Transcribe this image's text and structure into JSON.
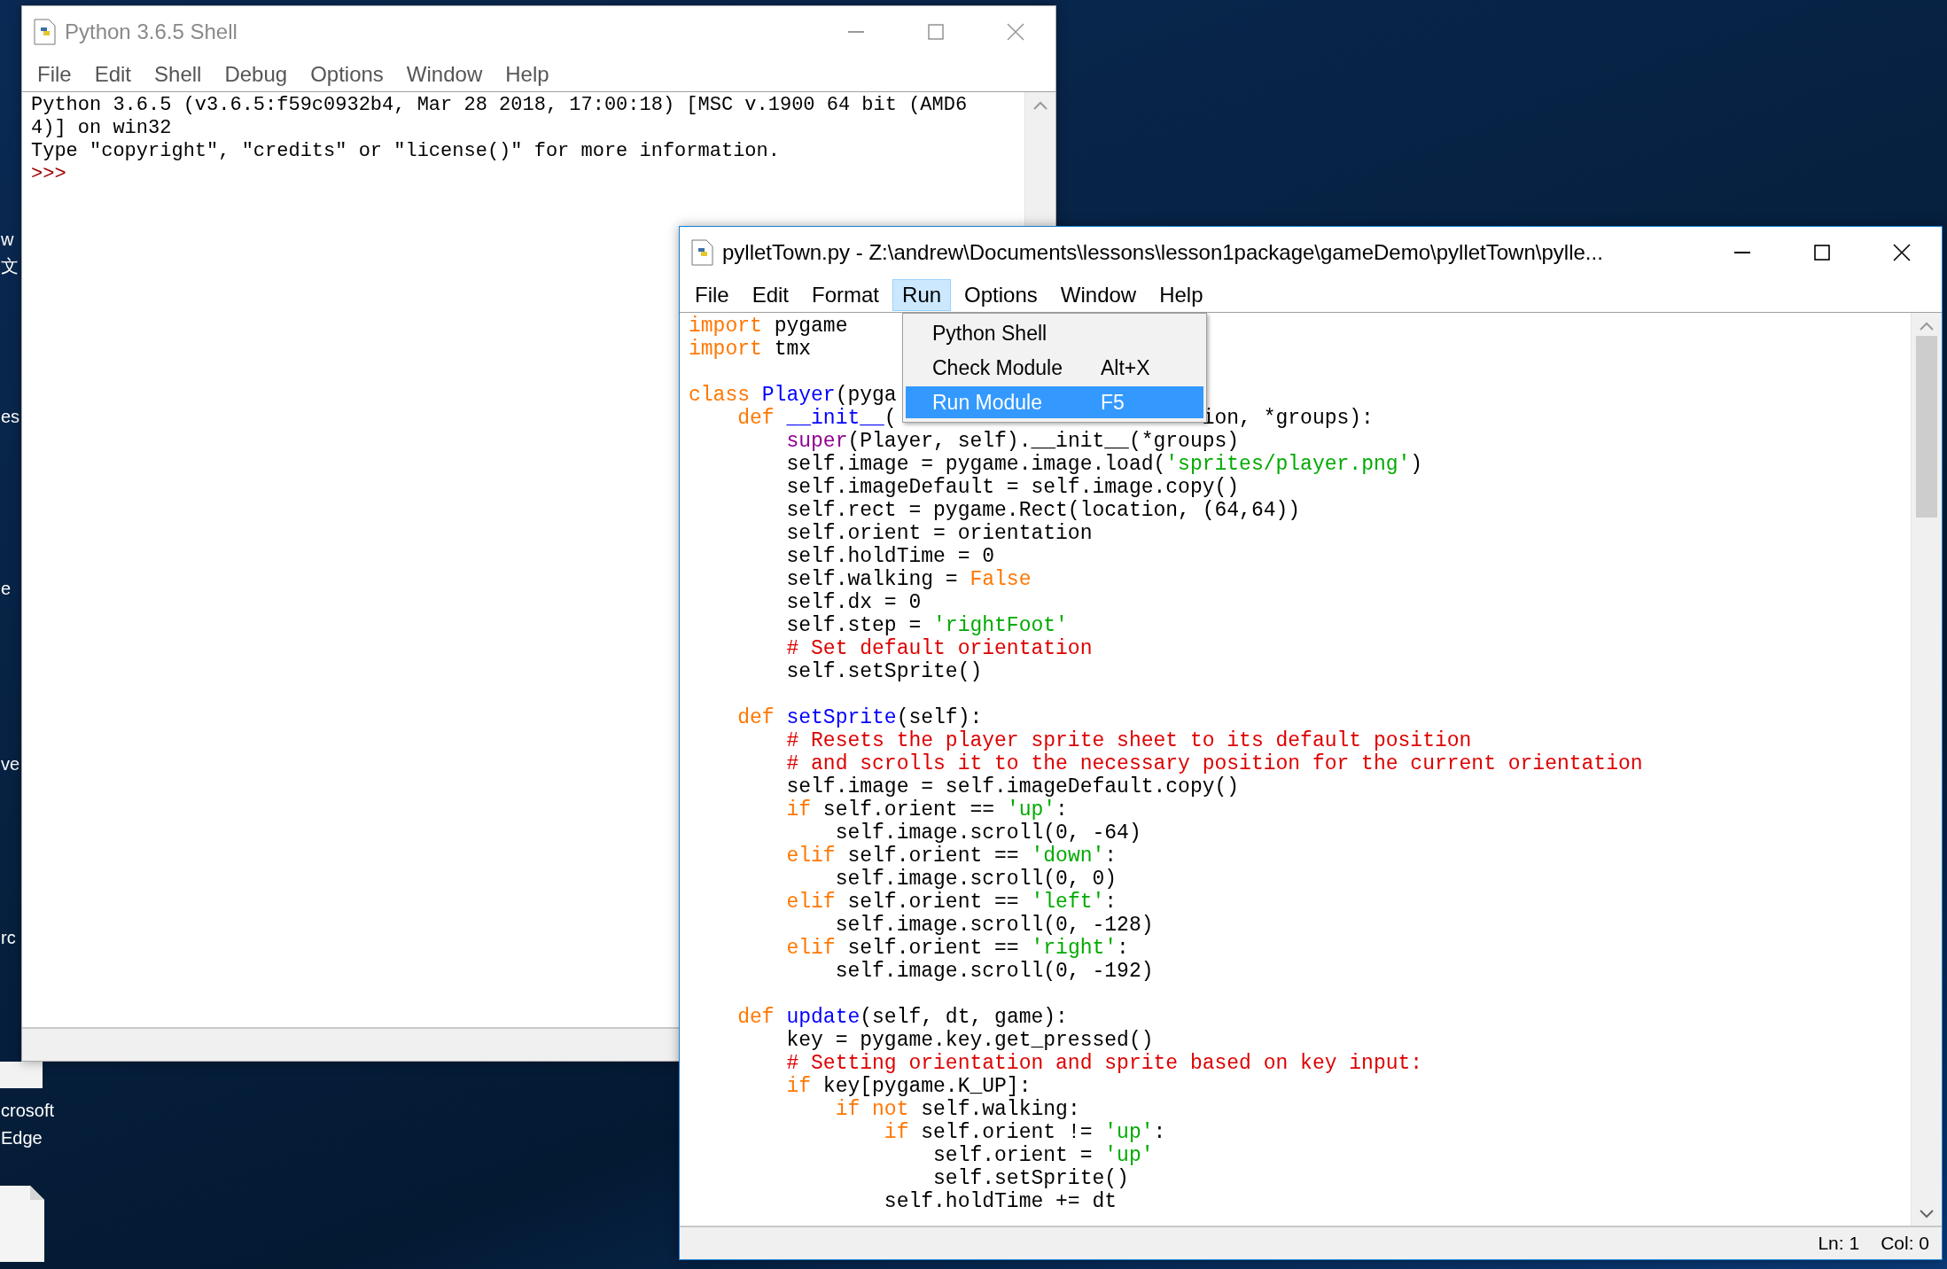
{
  "desktop": {
    "labels": [
      {
        "text": "w"
      },
      {
        "text": "文"
      },
      {
        "text": "es"
      },
      {
        "text": "e"
      },
      {
        "text": "ve"
      },
      {
        "text": "rc"
      },
      {
        "text": "crosoft"
      },
      {
        "text": "Edge"
      }
    ]
  },
  "shell_window": {
    "title": "Python 3.6.5 Shell",
    "active": false,
    "menu": [
      {
        "label": "File",
        "selected": false
      },
      {
        "label": "Edit",
        "selected": false
      },
      {
        "label": "Shell",
        "selected": false
      },
      {
        "label": "Debug",
        "selected": false
      },
      {
        "label": "Options",
        "selected": false
      },
      {
        "label": "Window",
        "selected": false
      },
      {
        "label": "Help",
        "selected": false
      }
    ],
    "output": [
      {
        "kind": "text",
        "text": "Python 3.6.5 (v3.6.5:f59c0932b4, Mar 28 2018, 17:00:18) [MSC v.1900 64 bit (AMD6"
      },
      {
        "kind": "text",
        "text": "4)] on win32"
      },
      {
        "kind": "text",
        "text": "Type \"copyright\", \"credits\" or \"license()\" for more information."
      },
      {
        "kind": "prompt",
        "text": ">>>"
      }
    ]
  },
  "editor_window": {
    "title": "pylletTown.py - Z:\\andrew\\Documents\\lessons\\lesson1package\\gameDemo\\pylletTown\\pylle...",
    "active": true,
    "menu": [
      {
        "label": "File",
        "selected": false
      },
      {
        "label": "Edit",
        "selected": false
      },
      {
        "label": "Format",
        "selected": false
      },
      {
        "label": "Run",
        "selected": true
      },
      {
        "label": "Options",
        "selected": false
      },
      {
        "label": "Window",
        "selected": false
      },
      {
        "label": "Help",
        "selected": false
      }
    ],
    "run_menu": [
      {
        "label": "Python Shell",
        "selected": false
      },
      {
        "label": "Check Module",
        "shortcut": "Alt+X",
        "selected": false
      },
      {
        "label": "Run Module",
        "shortcut": "F5",
        "selected": true
      }
    ],
    "code": [
      {
        "kind": "code",
        "segments": [
          {
            "tokens": [
              {
                "kind": "keyword",
                "text": "import"
              },
              {
                "kind": "plain",
                "text": " pygame"
              }
            ]
          }
        ]
      },
      {
        "kind": "code",
        "segments": [
          {
            "tokens": [
              {
                "kind": "keyword",
                "text": "import"
              },
              {
                "kind": "plain",
                "text": " tmx"
              }
            ]
          }
        ]
      },
      {
        "kind": "blank"
      },
      {
        "kind": "code",
        "segments": [
          {
            "tokens": [
              {
                "kind": "keyword",
                "text": "class"
              },
              {
                "kind": "definition",
                "text": " Player"
              },
              {
                "kind": "plain",
                "text": "(pyga"
              }
            ]
          }
        ]
      },
      {
        "kind": "code",
        "segments": [
          {
            "tokens": [
              {
                "kind": "keyword",
                "text": "    def"
              },
              {
                "kind": "definition",
                "text": " __init__"
              },
              {
                "kind": "plain",
                "text": "("
              }
            ]
          },
          {
            "tokens": [
              {
                "kind": "plain",
                "text": "ion, *groups):"
              }
            ]
          }
        ]
      },
      {
        "kind": "code",
        "segments": [
          {
            "tokens": [
              {
                "kind": "builtin",
                "text": "        super"
              },
              {
                "kind": "plain",
                "text": "(Player, self).__init__(*groups)"
              }
            ]
          }
        ]
      },
      {
        "kind": "code",
        "segments": [
          {
            "tokens": [
              {
                "kind": "plain",
                "text": "        self.image = pygame.image.load("
              },
              {
                "kind": "string",
                "text": "'sprites/player.png'"
              },
              {
                "kind": "plain",
                "text": ")"
              }
            ]
          }
        ]
      },
      {
        "kind": "code",
        "segments": [
          {
            "tokens": [
              {
                "kind": "plain",
                "text": "        self.imageDefault = self.image.copy()"
              }
            ]
          }
        ]
      },
      {
        "kind": "code",
        "segments": [
          {
            "tokens": [
              {
                "kind": "plain",
                "text": "        self.rect = pygame.Rect(location, (64,64))"
              }
            ]
          }
        ]
      },
      {
        "kind": "code",
        "segments": [
          {
            "tokens": [
              {
                "kind": "plain",
                "text": "        self.orient = orientation"
              }
            ]
          }
        ]
      },
      {
        "kind": "code",
        "segments": [
          {
            "tokens": [
              {
                "kind": "plain",
                "text": "        self.holdTime = 0"
              }
            ]
          }
        ]
      },
      {
        "kind": "code",
        "segments": [
          {
            "tokens": [
              {
                "kind": "plain",
                "text": "        self.walking ="
              },
              {
                "kind": "keyword",
                "text": " False"
              }
            ]
          }
        ]
      },
      {
        "kind": "code",
        "segments": [
          {
            "tokens": [
              {
                "kind": "plain",
                "text": "        self.dx = 0"
              }
            ]
          }
        ]
      },
      {
        "kind": "code",
        "segments": [
          {
            "tokens": [
              {
                "kind": "plain",
                "text": "        self.step ="
              },
              {
                "kind": "string",
                "text": " 'rightFoot'"
              }
            ]
          }
        ]
      },
      {
        "kind": "code",
        "segments": [
          {
            "tokens": [
              {
                "kind": "comment",
                "text": "        # Set default orientation"
              }
            ]
          }
        ]
      },
      {
        "kind": "code",
        "segments": [
          {
            "tokens": [
              {
                "kind": "plain",
                "text": "        self.setSprite()"
              }
            ]
          }
        ]
      },
      {
        "kind": "blank"
      },
      {
        "kind": "code",
        "segments": [
          {
            "tokens": [
              {
                "kind": "keyword",
                "text": "    def"
              },
              {
                "kind": "definition",
                "text": " setSprite"
              },
              {
                "kind": "plain",
                "text": "(self):"
              }
            ]
          }
        ]
      },
      {
        "kind": "code",
        "segments": [
          {
            "tokens": [
              {
                "kind": "comment",
                "text": "        # Resets the player sprite sheet to its default position"
              }
            ]
          }
        ]
      },
      {
        "kind": "code",
        "segments": [
          {
            "tokens": [
              {
                "kind": "comment",
                "text": "        # and scrolls it to the necessary position for the current orientation"
              }
            ]
          }
        ]
      },
      {
        "kind": "code",
        "segments": [
          {
            "tokens": [
              {
                "kind": "plain",
                "text": "        self.image = self.imageDefault.copy()"
              }
            ]
          }
        ]
      },
      {
        "kind": "code",
        "segments": [
          {
            "tokens": [
              {
                "kind": "keyword",
                "text": "        if"
              },
              {
                "kind": "plain",
                "text": " self.orient =="
              },
              {
                "kind": "string",
                "text": " 'up'"
              },
              {
                "kind": "plain",
                "text": ":"
              }
            ]
          }
        ]
      },
      {
        "kind": "code",
        "segments": [
          {
            "tokens": [
              {
                "kind": "plain",
                "text": "            self.image.scroll(0, -64)"
              }
            ]
          }
        ]
      },
      {
        "kind": "code",
        "segments": [
          {
            "tokens": [
              {
                "kind": "keyword",
                "text": "        elif"
              },
              {
                "kind": "plain",
                "text": " self.orient =="
              },
              {
                "kind": "string",
                "text": " 'down'"
              },
              {
                "kind": "plain",
                "text": ":"
              }
            ]
          }
        ]
      },
      {
        "kind": "code",
        "segments": [
          {
            "tokens": [
              {
                "kind": "plain",
                "text": "            self.image.scroll(0, 0)"
              }
            ]
          }
        ]
      },
      {
        "kind": "code",
        "segments": [
          {
            "tokens": [
              {
                "kind": "keyword",
                "text": "        elif"
              },
              {
                "kind": "plain",
                "text": " self.orient =="
              },
              {
                "kind": "string",
                "text": " 'left'"
              },
              {
                "kind": "plain",
                "text": ":"
              }
            ]
          }
        ]
      },
      {
        "kind": "code",
        "segments": [
          {
            "tokens": [
              {
                "kind": "plain",
                "text": "            self.image.scroll(0, -128)"
              }
            ]
          }
        ]
      },
      {
        "kind": "code",
        "segments": [
          {
            "tokens": [
              {
                "kind": "keyword",
                "text": "        elif"
              },
              {
                "kind": "plain",
                "text": " self.orient =="
              },
              {
                "kind": "string",
                "text": " 'right'"
              },
              {
                "kind": "plain",
                "text": ":"
              }
            ]
          }
        ]
      },
      {
        "kind": "code",
        "segments": [
          {
            "tokens": [
              {
                "kind": "plain",
                "text": "            self.image.scroll(0, -192)"
              }
            ]
          }
        ]
      },
      {
        "kind": "blank"
      },
      {
        "kind": "code",
        "segments": [
          {
            "tokens": [
              {
                "kind": "keyword",
                "text": "    def"
              },
              {
                "kind": "definition",
                "text": " update"
              },
              {
                "kind": "plain",
                "text": "(self, dt, game):"
              }
            ]
          }
        ]
      },
      {
        "kind": "code",
        "segments": [
          {
            "tokens": [
              {
                "kind": "plain",
                "text": "        key = pygame.key.get_pressed()"
              }
            ]
          }
        ]
      },
      {
        "kind": "code",
        "segments": [
          {
            "tokens": [
              {
                "kind": "comment",
                "text": "        # Setting orientation and sprite based on key input:"
              }
            ]
          }
        ]
      },
      {
        "kind": "code",
        "segments": [
          {
            "tokens": [
              {
                "kind": "keyword",
                "text": "        if"
              },
              {
                "kind": "plain",
                "text": " key[pygame.K_UP]:"
              }
            ]
          }
        ]
      },
      {
        "kind": "code",
        "segments": [
          {
            "tokens": [
              {
                "kind": "keyword",
                "text": "            if not"
              },
              {
                "kind": "plain",
                "text": " self.walking:"
              }
            ]
          }
        ]
      },
      {
        "kind": "code",
        "segments": [
          {
            "tokens": [
              {
                "kind": "keyword",
                "text": "                if"
              },
              {
                "kind": "plain",
                "text": " self.orient !="
              },
              {
                "kind": "string",
                "text": " 'up'"
              },
              {
                "kind": "plain",
                "text": ":"
              }
            ]
          }
        ]
      },
      {
        "kind": "code",
        "segments": [
          {
            "tokens": [
              {
                "kind": "plain",
                "text": "                    self.orient ="
              },
              {
                "kind": "string",
                "text": " 'up'"
              }
            ]
          }
        ]
      },
      {
        "kind": "code",
        "segments": [
          {
            "tokens": [
              {
                "kind": "plain",
                "text": "                    self.setSprite()"
              }
            ]
          }
        ]
      },
      {
        "kind": "code",
        "segments": [
          {
            "tokens": [
              {
                "kind": "plain",
                "text": "                self.holdTime += dt"
              }
            ]
          }
        ]
      }
    ],
    "status_bar": {
      "line": "Ln: 1",
      "column": "Col: 0"
    }
  }
}
